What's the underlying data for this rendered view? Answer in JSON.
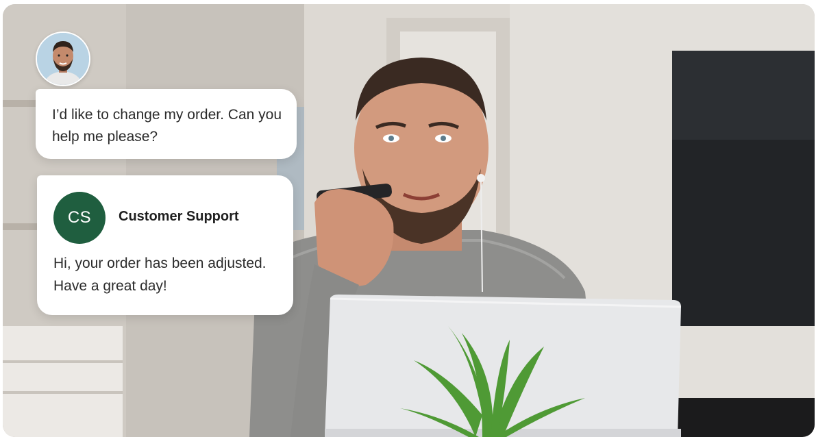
{
  "user_message": {
    "avatar_icon": "user-avatar-icon",
    "text": "I’d like to change my order. Can you help me please?"
  },
  "support_message": {
    "avatar_initials": "CS",
    "avatar_color": "#1f5e3f",
    "sender": "Customer Support",
    "text": "Hi, your order has been adjusted. Have a great day!"
  },
  "photo": {
    "subject": "man speaking into phone at laptop with plant"
  },
  "colors": {
    "bubble": "#ffffff",
    "accent_green": "#1f5e3f"
  }
}
